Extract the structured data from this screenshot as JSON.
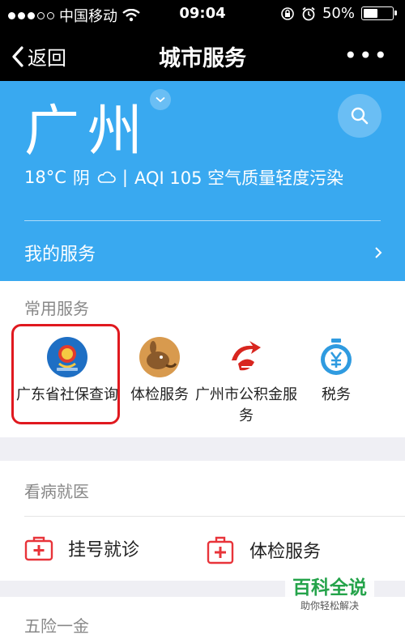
{
  "status_bar": {
    "carrier": "中国移动",
    "time": "09:04",
    "battery": "50%",
    "battery_level": 0.5
  },
  "nav": {
    "back_label": "返回",
    "title": "城市服务"
  },
  "hero": {
    "city": "广州",
    "temperature": "18°C",
    "condition": "阴",
    "separator": "|",
    "aqi": "AQI 105 空气质量轻度污染",
    "my_service": "我的服务"
  },
  "common": {
    "title": "常用服务",
    "items": [
      {
        "label": "广东省社保查询",
        "icon": "social-insurance-emblem-icon"
      },
      {
        "label": "体检服务",
        "icon": "health-check-animal-icon"
      },
      {
        "label": "广州市公积金服务",
        "icon": "housing-fund-logo-icon"
      },
      {
        "label": "税务",
        "icon": "tax-yen-icon"
      }
    ]
  },
  "medical": {
    "title": "看病就医",
    "items": [
      {
        "label": "挂号就诊",
        "icon": "first-aid-kit-icon"
      },
      {
        "label": "体检服务",
        "icon": "medical-checkup-icon"
      }
    ]
  },
  "insurance": {
    "title": "五险一金"
  },
  "watermark": {
    "main": "百科全说",
    "sub": "助你轻松解决"
  },
  "colors": {
    "hero_bg": "#39a9f0",
    "highlight": "#e0191f",
    "medical_icon": "#e8343a",
    "watermark": "#24a34a"
  }
}
